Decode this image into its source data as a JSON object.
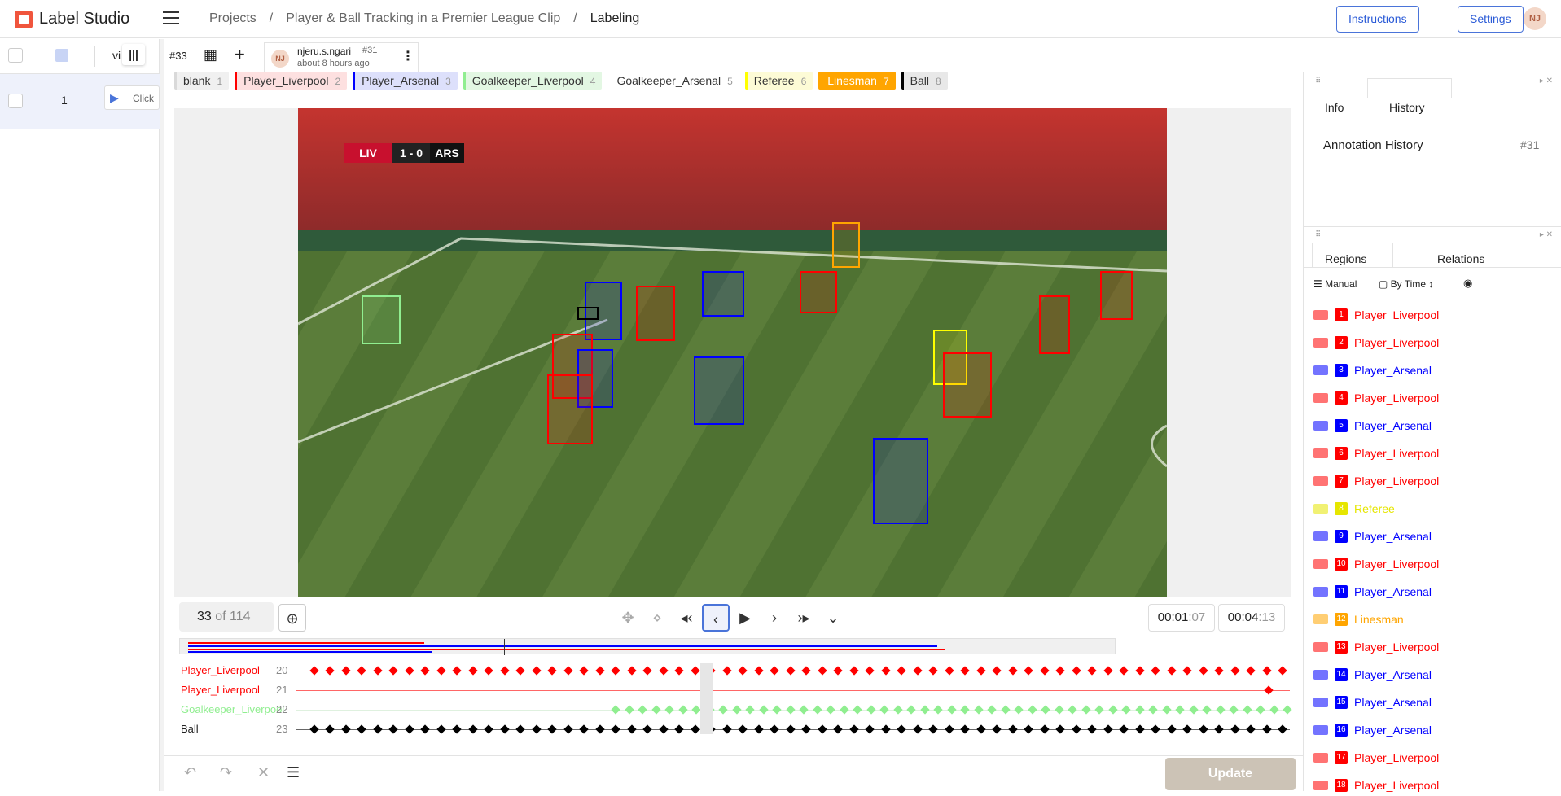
{
  "app": {
    "name": "Label Studio"
  },
  "breadcrumbs": [
    "Projects",
    "Player & Ball Tracking in a Premier League Clip",
    "Labeling"
  ],
  "header": {
    "instructions": "Instructions",
    "settings": "Settings",
    "avatar": "NJ"
  },
  "left_panel": {
    "view_label": "vi",
    "row_index": "1",
    "row_action": "Click"
  },
  "annotation": {
    "task_id": "#33",
    "user": "njeru.s.ngari",
    "annotation_id": "#31",
    "time_ago": "about 8 hours ago",
    "avatar": "NJ"
  },
  "labels": [
    {
      "name": "blank",
      "key": "1",
      "color": "#d9d9d9"
    },
    {
      "name": "Player_Liverpool",
      "key": "2",
      "color": "#ff0000"
    },
    {
      "name": "Player_Arsenal",
      "key": "3",
      "color": "#0000ff"
    },
    {
      "name": "Goalkeeper_Liverpool",
      "key": "4",
      "color": "#90ee90"
    },
    {
      "name": "Goalkeeper_Arsenal",
      "key": "5",
      "color": "#ffffff"
    },
    {
      "name": "Referee",
      "key": "6",
      "color": "#ffff00"
    },
    {
      "name": "Linesman",
      "key": "7",
      "color": "#ffa500"
    },
    {
      "name": "Ball",
      "key": "8",
      "color": "#000000"
    }
  ],
  "scoreboard": {
    "home": "LIV",
    "score": "1 - 0",
    "away": "ARS"
  },
  "player": {
    "frame": "33",
    "of_total": "of 114",
    "time_current": "00:01",
    "time_current_frac": ":07",
    "time_total": "00:04",
    "time_total_frac": ":13"
  },
  "timeline_rows": [
    {
      "label": "Player_Liverpool",
      "num": "20",
      "color": "#ff0000"
    },
    {
      "label": "Player_Liverpool",
      "num": "21",
      "color": "#ff0000"
    },
    {
      "label": "Goalkeeper_Liverpool",
      "num": "22",
      "color": "#90ee90"
    },
    {
      "label": "Ball",
      "num": "23",
      "color": "#000000"
    }
  ],
  "bottom": {
    "update": "Update"
  },
  "right_panel": {
    "tab_info": "Info",
    "tab_history": "History",
    "history_title": "Annotation History",
    "history_id": "#31",
    "tab_regions": "Regions",
    "tab_relations": "Relations",
    "sort_manual": "Manual",
    "sort_by_time": "By Time"
  },
  "regions": [
    {
      "n": "1",
      "label": "Player_Liverpool",
      "color": "#ff0000"
    },
    {
      "n": "2",
      "label": "Player_Liverpool",
      "color": "#ff0000"
    },
    {
      "n": "3",
      "label": "Player_Arsenal",
      "color": "#0000ff"
    },
    {
      "n": "4",
      "label": "Player_Liverpool",
      "color": "#ff0000"
    },
    {
      "n": "5",
      "label": "Player_Arsenal",
      "color": "#0000ff"
    },
    {
      "n": "6",
      "label": "Player_Liverpool",
      "color": "#ff0000"
    },
    {
      "n": "7",
      "label": "Player_Liverpool",
      "color": "#ff0000"
    },
    {
      "n": "8",
      "label": "Referee",
      "color": "#e6e600"
    },
    {
      "n": "9",
      "label": "Player_Arsenal",
      "color": "#0000ff"
    },
    {
      "n": "10",
      "label": "Player_Liverpool",
      "color": "#ff0000"
    },
    {
      "n": "11",
      "label": "Player_Arsenal",
      "color": "#0000ff"
    },
    {
      "n": "12",
      "label": "Linesman",
      "color": "#ffa500"
    },
    {
      "n": "13",
      "label": "Player_Liverpool",
      "color": "#ff0000"
    },
    {
      "n": "14",
      "label": "Player_Arsenal",
      "color": "#0000ff"
    },
    {
      "n": "15",
      "label": "Player_Arsenal",
      "color": "#0000ff"
    },
    {
      "n": "16",
      "label": "Player_Arsenal",
      "color": "#0000ff"
    },
    {
      "n": "17",
      "label": "Player_Liverpool",
      "color": "#ff0000"
    },
    {
      "n": "18",
      "label": "Player_Liverpool",
      "color": "#ff0000"
    }
  ]
}
